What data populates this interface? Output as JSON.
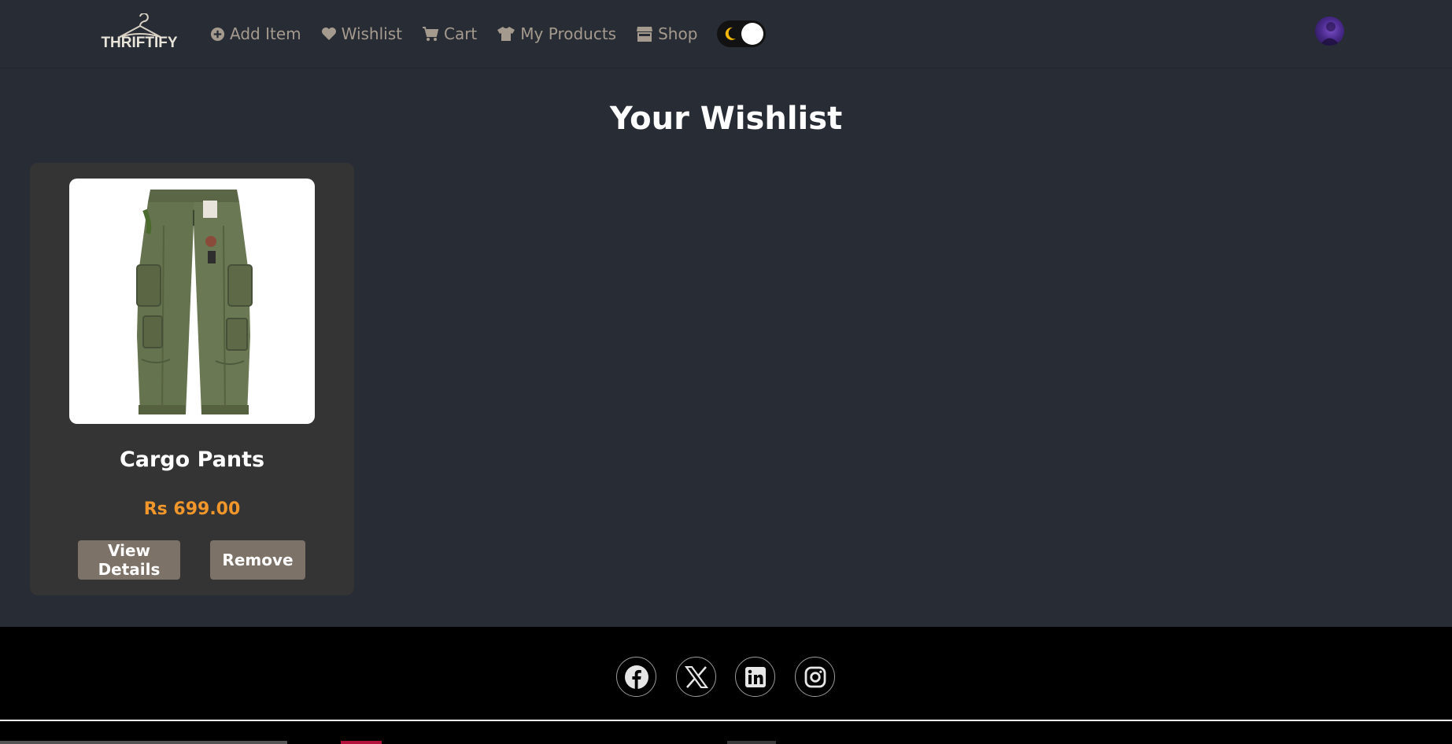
{
  "brand": {
    "name": "THRIFTIFY"
  },
  "nav": {
    "items": [
      {
        "label": "Add Item",
        "icon": "plus-circle-icon"
      },
      {
        "label": "Wishlist",
        "icon": "heart-icon"
      },
      {
        "label": "Cart",
        "icon": "cart-icon"
      },
      {
        "label": "My Products",
        "icon": "tshirt-icon"
      },
      {
        "label": "Shop",
        "icon": "store-icon"
      }
    ],
    "theme_toggle": {
      "mode": "dark",
      "icon": "moon-icon"
    }
  },
  "page": {
    "title": "Your Wishlist"
  },
  "wishlist": {
    "items": [
      {
        "name": "Cargo Pants",
        "price": "Rs 699.00",
        "image": "cargo-pants-image",
        "view_label": "View Details",
        "remove_label": "Remove"
      }
    ]
  },
  "footer": {
    "social": [
      "facebook-icon",
      "x-icon",
      "linkedin-icon",
      "instagram-icon"
    ]
  },
  "colors": {
    "background": "#282c35",
    "nav_text": "#a59a8e",
    "price": "#f0962a",
    "button": "#7d7268",
    "card": "#343434",
    "footer": "#000000"
  }
}
